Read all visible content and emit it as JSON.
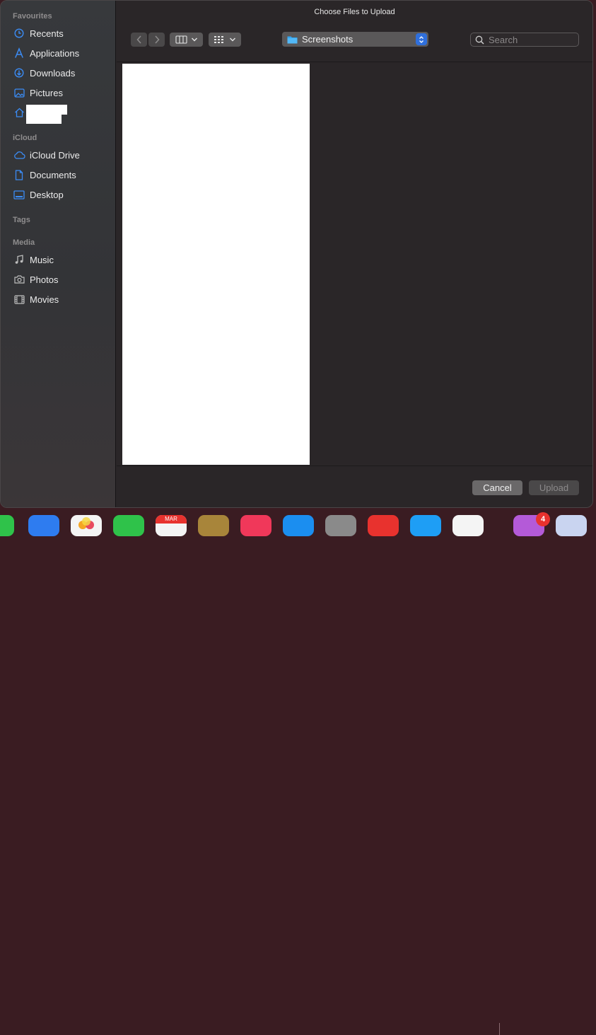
{
  "window": {
    "title": "Choose Files to Upload"
  },
  "sidebar": {
    "sections": {
      "favourites": "Favourites",
      "icloud": "iCloud",
      "tags": "Tags",
      "media": "Media"
    },
    "favourites": [
      {
        "label": "Recents",
        "icon": "clock-icon"
      },
      {
        "label": "Applications",
        "icon": "applications-icon"
      },
      {
        "label": "Downloads",
        "icon": "download-icon"
      },
      {
        "label": "Pictures",
        "icon": "pictures-icon"
      },
      {
        "label": "",
        "icon": "home-icon"
      }
    ],
    "icloud": [
      {
        "label": "iCloud Drive",
        "icon": "cloud-icon"
      },
      {
        "label": "Documents",
        "icon": "document-icon"
      },
      {
        "label": "Desktop",
        "icon": "desktop-icon"
      }
    ],
    "media": [
      {
        "label": "Music",
        "icon": "music-icon"
      },
      {
        "label": "Photos",
        "icon": "camera-icon"
      },
      {
        "label": "Movies",
        "icon": "film-icon"
      }
    ]
  },
  "toolbar": {
    "location": "Screenshots",
    "search_placeholder": "Search"
  },
  "footer": {
    "cancel_label": "Cancel",
    "upload_label": "Upload"
  },
  "dock": {
    "calendar_month": "MAR",
    "badge_count": "4"
  },
  "colors": {
    "accent": "#2f6fdc",
    "sidebar_icon": "#3b8cf5"
  }
}
